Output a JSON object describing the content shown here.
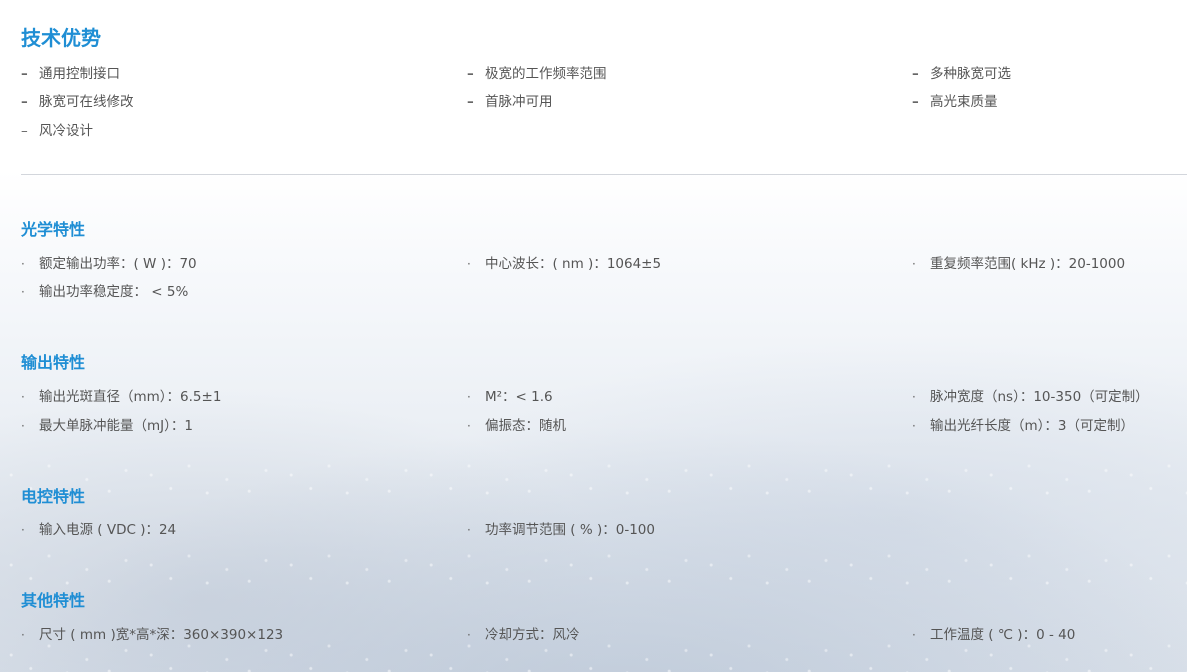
{
  "advantages": {
    "title": "技术优势",
    "items": [
      [
        "通用控制接口",
        "极宽的工作频率范围",
        "多种脉宽可选"
      ],
      [
        "脉宽可在线修改",
        "首脉冲可用",
        "高光束质量"
      ],
      [
        "风冷设计"
      ]
    ]
  },
  "optical": {
    "title": "光学特性",
    "items": [
      [
        "额定输出功率：( W )：70",
        "中心波长：( nm )：1064±5",
        "重复频率范围( kHz )：20-1000"
      ],
      [
        "输出功率稳定度： < 5%"
      ]
    ]
  },
  "output": {
    "title": "输出特性",
    "items": [
      [
        "输出光斑直径（mm）：6.5±1",
        "M²：< 1.6",
        "脉冲宽度（ns）：10-350（可定制）"
      ],
      [
        "最大单脉冲能量（mJ）：1",
        "偏振态：随机",
        "输出光纤长度（m）：3（可定制）"
      ]
    ]
  },
  "electric": {
    "title": "电控特性",
    "items": [
      [
        "输入电源 ( VDC )：24",
        "功率调节范围 ( % )：0-100"
      ]
    ]
  },
  "other": {
    "title": "其他特性",
    "items": [
      [
        "尺寸 ( mm )宽*高*深：360×390×123",
        "冷却方式：风冷",
        "工作温度 ( ℃ )：0 - 40"
      ]
    ]
  },
  "bullets": {
    "dash": "–",
    "dot": "·"
  },
  "colors": {
    "heading": "#1f8ed4",
    "text": "#555555",
    "divider": "#d3d6dc"
  }
}
